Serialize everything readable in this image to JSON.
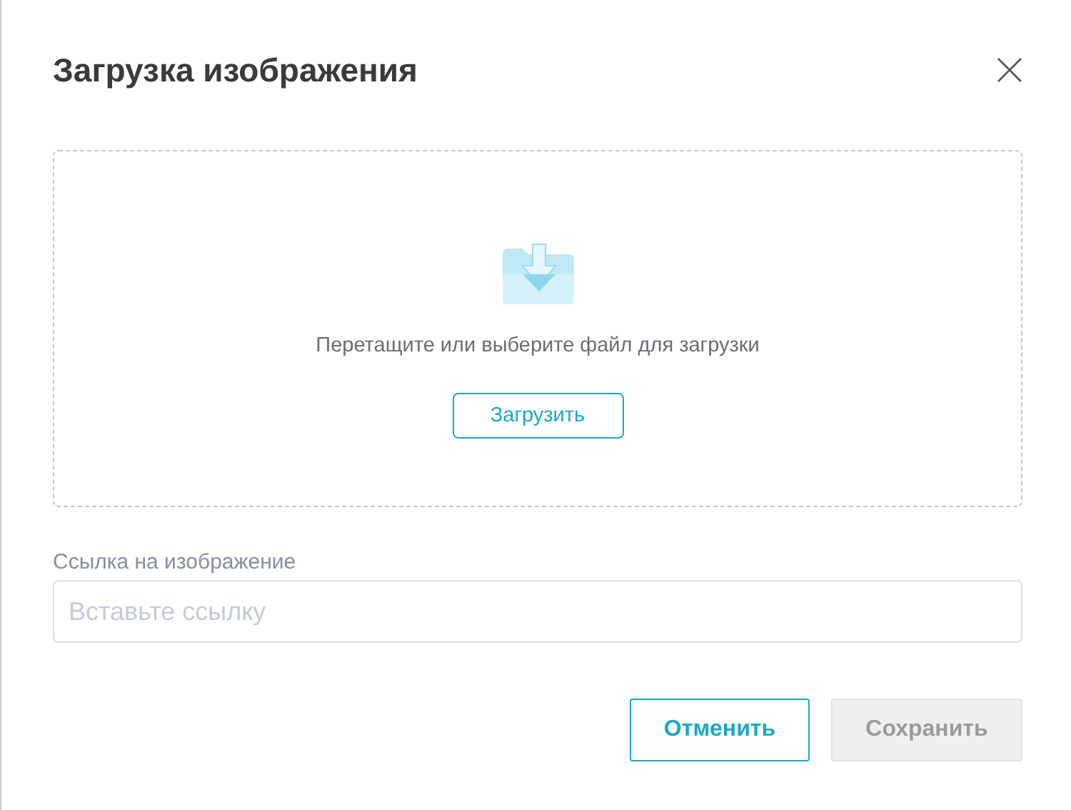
{
  "dialog": {
    "title": "Загрузка изображения"
  },
  "dropzone": {
    "hint": "Перетащите или выберите файл для загрузки",
    "upload_button": "Загрузить"
  },
  "link_field": {
    "label": "Ссылка на изображение",
    "placeholder": "Вставьте ссылку"
  },
  "buttons": [
    {
      "label": "Отменить",
      "kind": "secondary",
      "disabled": false
    },
    {
      "label": "Сохранить",
      "kind": "primary",
      "disabled": true
    }
  ]
}
